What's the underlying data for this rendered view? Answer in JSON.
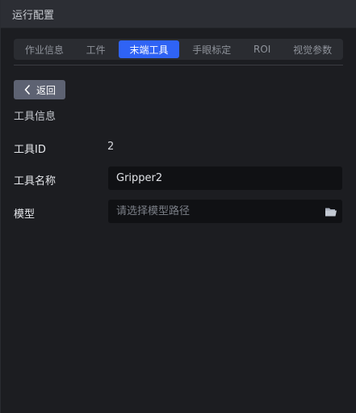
{
  "window": {
    "title": "运行配置"
  },
  "tabs": [
    {
      "label": "作业信息",
      "active": false
    },
    {
      "label": "工件",
      "active": false
    },
    {
      "label": "末端工具",
      "active": true
    },
    {
      "label": "手眼标定",
      "active": false
    },
    {
      "label": "ROI",
      "active": false
    },
    {
      "label": "视觉参数",
      "active": false
    }
  ],
  "back_button": {
    "label": "返回",
    "icon": "chevron-left-icon"
  },
  "section": {
    "title": "工具信息"
  },
  "tool_id": {
    "label": "工具ID",
    "value": "2"
  },
  "tool_name": {
    "label": "工具名称",
    "value": "Gripper2"
  },
  "model": {
    "label": "模型",
    "placeholder": "请选择模型路径",
    "icon": "folder-icon"
  },
  "colors": {
    "accent": "#2f63f5",
    "background": "#1c1d21",
    "titlebar": "#2c2e34"
  }
}
